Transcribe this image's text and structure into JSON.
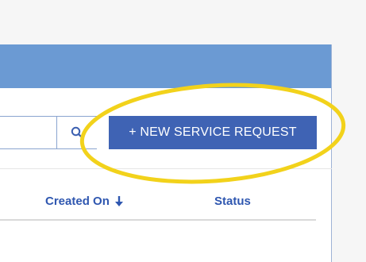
{
  "search": {
    "value": "",
    "placeholder": ""
  },
  "toolbar": {
    "new_request_label": "+ NEW SERVICE REQUEST"
  },
  "table": {
    "columns": [
      {
        "label": "Created On",
        "sort": "descending"
      },
      {
        "label": "Status"
      }
    ]
  },
  "icons": {
    "search": "search-icon",
    "sort": "arrow-down-icon"
  },
  "colors": {
    "header": "#6b9ad3",
    "primary_button": "#3f63b4",
    "column_text": "#2f57b0",
    "highlight": "#f2d21b"
  }
}
